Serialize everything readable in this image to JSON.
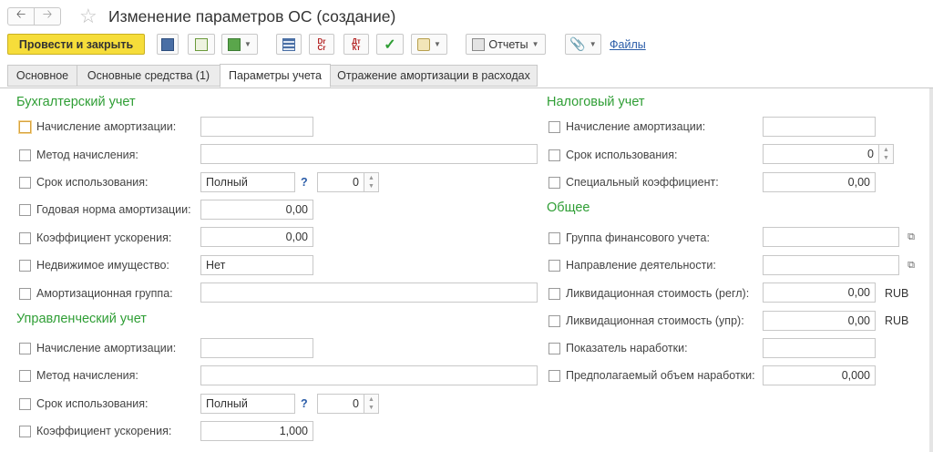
{
  "window": {
    "title": "Изменение параметров ОС (создание)",
    "back_icon": "arrow-left-icon",
    "forward_icon": "arrow-right-icon",
    "favorite_icon": "star-icon"
  },
  "toolbar": {
    "primary_label": "Провести и закрыть",
    "reports_label": "Отчеты",
    "files_label": "Файлы",
    "drcr_label_top": "Dr",
    "drcr_label_bottom": "Cr",
    "dtkt_label_top": "Дт",
    "dtkt_label_bottom": "Кт",
    "accent_color": "#f6dd3a"
  },
  "tabs": [
    {
      "label": "Основное",
      "active": false
    },
    {
      "label": "Основные средства (1)",
      "active": false
    },
    {
      "label": "Параметры учета",
      "active": true
    },
    {
      "label": "Отражение амортизации в расходах",
      "active": false
    }
  ],
  "accounting": {
    "heading": "Бухгалтерский учет",
    "rows": {
      "amortization": {
        "label": "Начисление амортизации:",
        "value": ""
      },
      "method": {
        "label": "Метод начисления:",
        "value": ""
      },
      "term": {
        "label": "Срок использования:",
        "value": "Полный",
        "help": "?",
        "number": "0"
      },
      "annual_rate": {
        "label": "Годовая норма амортизации:",
        "value": "0,00"
      },
      "acceleration": {
        "label": "Коэффициент ускорения:",
        "value": "0,00"
      },
      "real_estate": {
        "label": "Недвижимое имущество:",
        "value": "Нет"
      },
      "depr_group": {
        "label": "Амортизационная группа:",
        "value": ""
      }
    }
  },
  "management": {
    "heading": "Управленческий учет",
    "rows": {
      "amortization": {
        "label": "Начисление амортизации:",
        "value": ""
      },
      "method": {
        "label": "Метод начисления:",
        "value": ""
      },
      "term": {
        "label": "Срок использования:",
        "value": "Полный",
        "help": "?",
        "number": "0"
      },
      "acceleration": {
        "label": "Коэффициент ускорения:",
        "value": "1,000"
      }
    }
  },
  "tax": {
    "heading": "Налоговый учет",
    "rows": {
      "amortization": {
        "label": "Начисление амортизации:",
        "value": ""
      },
      "term": {
        "label": "Срок использования:",
        "value": "0"
      },
      "special_coef": {
        "label": "Специальный коэффициент:",
        "value": "0,00"
      }
    }
  },
  "general": {
    "heading": "Общее",
    "rows": {
      "fin_group": {
        "label": "Группа финансового учета:",
        "value": ""
      },
      "direction": {
        "label": "Направление деятельности:",
        "value": ""
      },
      "liq_regl": {
        "label": "Ликвидационная стоимость (регл):",
        "value": "0,00",
        "unit": "RUB"
      },
      "liq_upr": {
        "label": "Ликвидационная стоимость (упр):",
        "value": "0,00",
        "unit": "RUB"
      },
      "output_indicator": {
        "label": "Показатель наработки:",
        "value": ""
      },
      "expected_output": {
        "label": "Предполагаемый объем наработки:",
        "value": "0,000"
      }
    }
  }
}
